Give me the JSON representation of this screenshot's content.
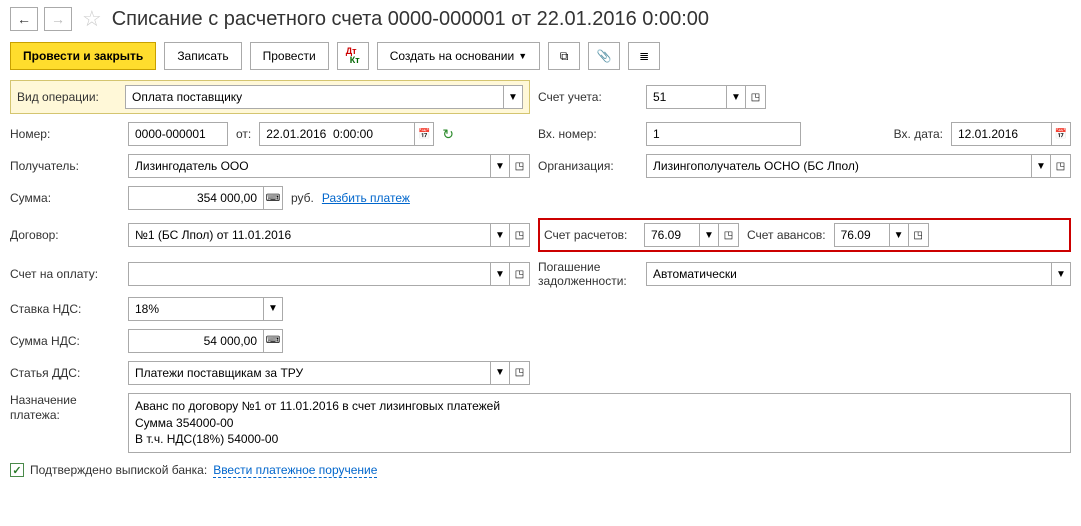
{
  "nav": {
    "back": "←",
    "forward": "→"
  },
  "header": {
    "star": "☆",
    "title": "Списание с расчетного счета 0000-000001 от 22.01.2016 0:00:00"
  },
  "toolbar": {
    "post_close": "Провести и закрыть",
    "save": "Записать",
    "post": "Провести",
    "create_based": "Создать на основании"
  },
  "labels": {
    "op_type": "Вид операции:",
    "account": "Счет учета:",
    "number": "Номер:",
    "date_from": "от:",
    "in_number": "Вх. номер:",
    "in_date": "Вх. дата:",
    "recipient": "Получатель:",
    "organization": "Организация:",
    "amount": "Сумма:",
    "currency": "руб.",
    "split": "Разбить платеж",
    "contract": "Договор:",
    "calc_account": "Счет расчетов:",
    "adv_account": "Счет авансов:",
    "invoice": "Счет на оплату:",
    "debt_repay": "Погашение задолженности:",
    "vat_rate": "Ставка НДС:",
    "vat_amount": "Сумма НДС:",
    "dds": "Статья ДДС:",
    "purpose": "Назначение платежа:",
    "confirmed": "Подтверждено выпиской банка:",
    "enter_order": "Ввести платежное поручение"
  },
  "values": {
    "op_type": "Оплата поставщику",
    "account": "51",
    "number": "0000-000001",
    "date": "22.01.2016  0:00:00",
    "in_number": "1",
    "in_date": "12.01.2016",
    "recipient": "Лизингодатель ООО",
    "organization": "Лизингополучатель ОСНО (БС Лпол)",
    "amount": "354 000,00",
    "contract": "№1 (БС Лпол) от 11.01.2016",
    "calc_account": "76.09",
    "adv_account": "76.09",
    "invoice": "",
    "debt_repay": "Автоматически",
    "vat_rate": "18%",
    "vat_amount": "54 000,00",
    "dds": "Платежи поставщикам за ТРУ",
    "purpose": "Аванс по договору №1 от 11.01.2016 в счет лизинговых платежей\nСумма 354000-00\nВ т.ч. НДС(18%) 54000-00"
  }
}
